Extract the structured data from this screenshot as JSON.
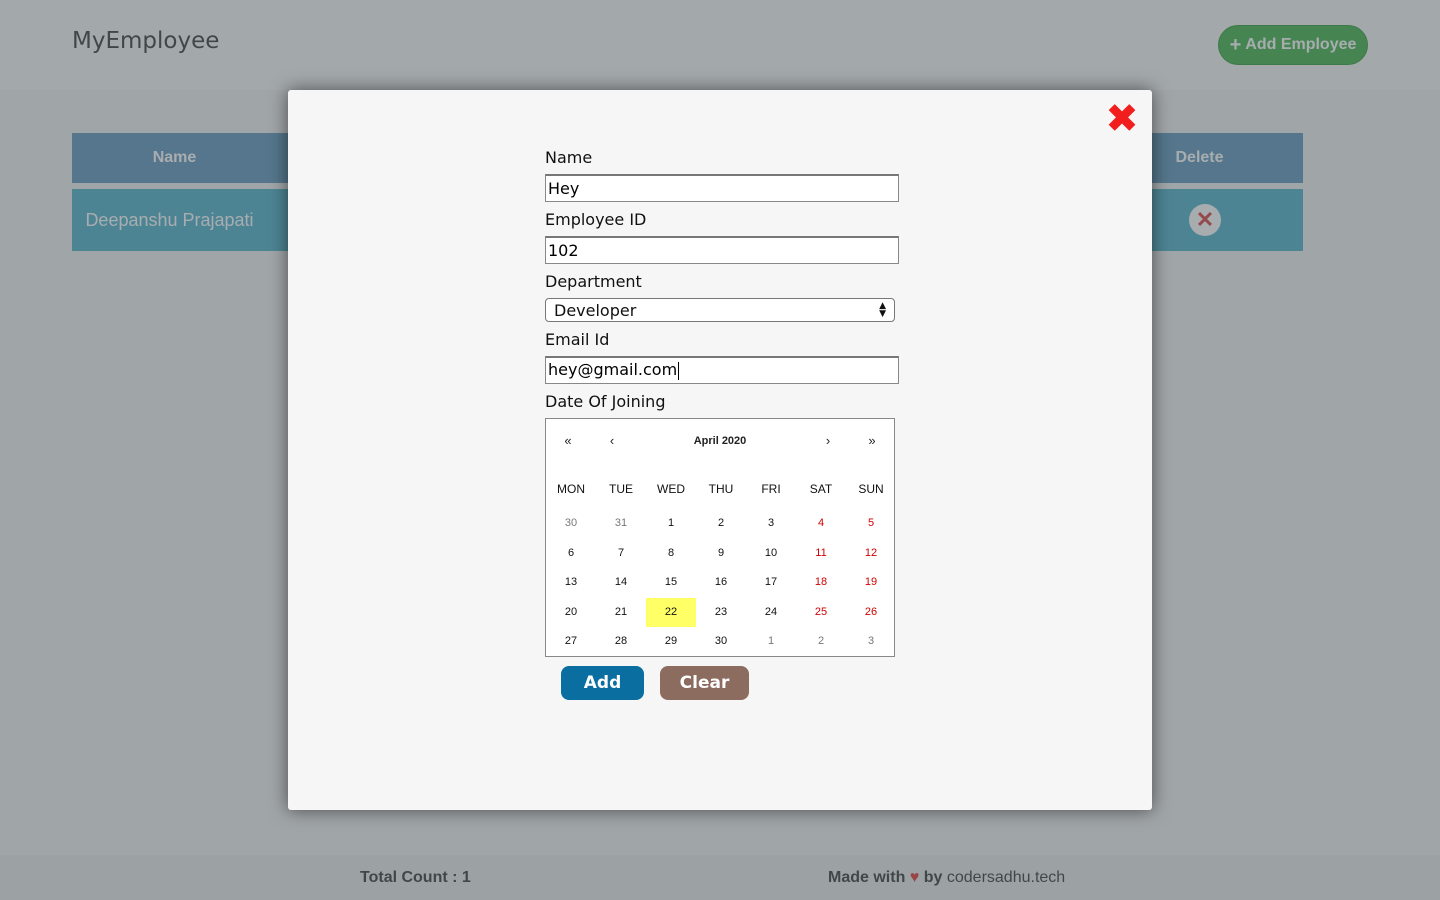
{
  "header": {
    "brand": "MyEmployee",
    "add_button_icon": "plus-icon",
    "add_button_label": "Add Employee"
  },
  "table": {
    "columns": {
      "name": "Name",
      "delete": "Delete"
    },
    "rows": [
      {
        "name": "Deepanshu Prajapati",
        "delete_icon": "close-circle-icon"
      }
    ]
  },
  "footer": {
    "total_label": "Total Count : ",
    "total_value": "1",
    "made_with": "Made with",
    "heart_icon": "heart-icon",
    "by": "by",
    "site": "codersadhu.tech"
  },
  "modal": {
    "close_icon": "close-icon",
    "form": {
      "name_label": "Name",
      "name_value": "Hey",
      "employee_id_label": "Employee ID",
      "employee_id_value": "102",
      "department_label": "Department",
      "department_value": "Developer",
      "email_label": "Email Id",
      "email_value": "hey@gmail.com",
      "doj_label": "Date Of Joining"
    },
    "calendar": {
      "nav": {
        "prev_year": "«",
        "prev_month": "‹",
        "next_month": "›",
        "next_year": "»"
      },
      "title": "April 2020",
      "weekdays": [
        "MON",
        "TUE",
        "WED",
        "THU",
        "FRI",
        "SAT",
        "SUN"
      ],
      "weeks": [
        [
          "30",
          "31",
          "1",
          "2",
          "3",
          "4",
          "5"
        ],
        [
          "6",
          "7",
          "8",
          "9",
          "10",
          "11",
          "12"
        ],
        [
          "13",
          "14",
          "15",
          "16",
          "17",
          "18",
          "19"
        ],
        [
          "20",
          "21",
          "22",
          "23",
          "24",
          "25",
          "26"
        ],
        [
          "27",
          "28",
          "29",
          "30",
          "1",
          "2",
          "3"
        ]
      ],
      "selected": "22",
      "weekend_color": "#d10000",
      "selected_color": "#ffff66"
    },
    "buttons": {
      "add": "Add",
      "clear": "Clear"
    }
  },
  "colors": {
    "add_button": "#0a6fa0",
    "clear_button": "#8d6c60",
    "close": "#f21d1d",
    "add_employee": "#3cb043"
  }
}
